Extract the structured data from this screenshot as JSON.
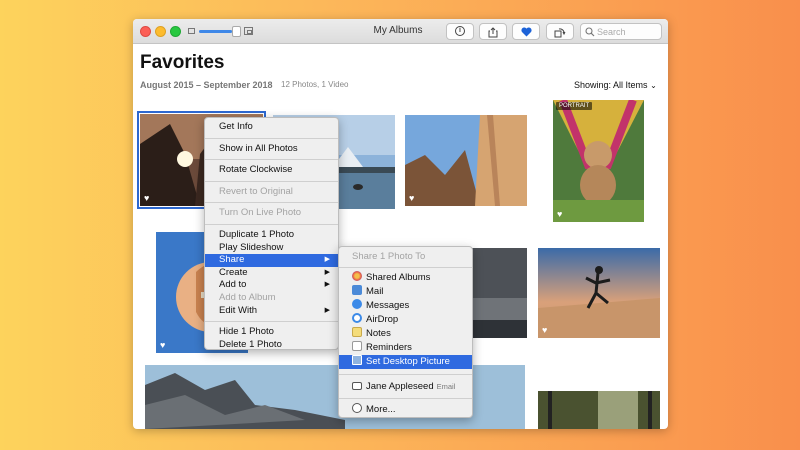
{
  "window": {
    "title": "My Albums",
    "search_placeholder": "Search"
  },
  "header": {
    "title": "Favorites",
    "date_range": "August 2015 – September 2018",
    "counts": "12 Photos, 1 Video",
    "showing_label": "Showing:",
    "showing_value": "All Items"
  },
  "photos": {
    "portrait_badge": "PORTRAIT"
  },
  "context_menu": {
    "get_info": "Get Info",
    "show_in_all": "Show in All Photos",
    "rotate": "Rotate Clockwise",
    "revert": "Revert to Original",
    "live_photo": "Turn On Live Photo",
    "duplicate": "Duplicate 1 Photo",
    "slideshow": "Play Slideshow",
    "share": "Share",
    "create": "Create",
    "add_to": "Add to",
    "add_to_album": "Add to Album",
    "edit_with": "Edit With",
    "hide": "Hide 1 Photo",
    "delete": "Delete 1 Photo"
  },
  "share_menu": {
    "header": "Share 1 Photo To",
    "shared_albums": "Shared Albums",
    "mail": "Mail",
    "messages": "Messages",
    "airdrop": "AirDrop",
    "notes": "Notes",
    "reminders": "Reminders",
    "desktop": "Set Desktop Picture",
    "contact_name": "Jane Appleseed",
    "contact_method": "Email",
    "more": "More..."
  },
  "colors": {
    "accent": "#2f6ae0",
    "favorite_blue": "#1d63d8"
  }
}
